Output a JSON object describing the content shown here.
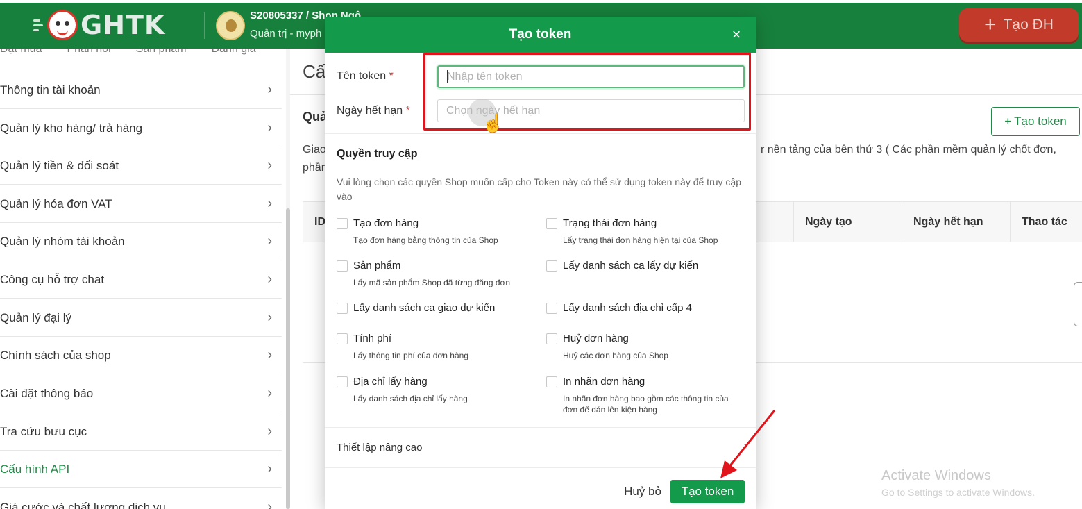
{
  "header": {
    "brand": "GHTK",
    "shop_code": "S20805337 / Shop Ngô",
    "shop_role": "Quản trị - myph",
    "create_order": "Tạo ĐH",
    "plus_icon": "+"
  },
  "sidebar": {
    "tabs": [
      "Đặt mua",
      "Phản hồi",
      "Sản phẩm",
      "Đánh giá"
    ],
    "items": [
      {
        "label": "Thông tin tài khoản"
      },
      {
        "label": "Quản lý kho hàng/ trả hàng"
      },
      {
        "label": "Quản lý tiền & đối soát"
      },
      {
        "label": "Quản lý hóa đơn VAT"
      },
      {
        "label": "Quản lý nhóm tài khoản"
      },
      {
        "label": "Công cụ hỗ trợ chat"
      },
      {
        "label": "Quản lý đại lý"
      },
      {
        "label": "Chính sách của shop"
      },
      {
        "label": "Cài đặt thông báo"
      },
      {
        "label": "Tra cứu bưu cục"
      },
      {
        "label": "Cấu hình API",
        "active": true
      },
      {
        "label": "Giá cước và chất lượng dịch vụ"
      }
    ],
    "chevron": "›"
  },
  "main": {
    "title": "Cấu",
    "subtitle": "Quả",
    "create_token_btn": "Tạo token",
    "desc_left": "Giao",
    "desc_right": "r nền tảng của bên thứ 3 ( Các phần mềm quản lý chốt đơn,",
    "desc_line2": "phần",
    "table_headers": {
      "id": "ID",
      "created": "Ngày tạo",
      "expiry": "Ngày hết hạn",
      "action": "Thao tác"
    }
  },
  "modal": {
    "title": "Tạo token",
    "close_icon": "×",
    "token_name_label": "Tên token",
    "token_name_placeholder": "Nhập tên token",
    "token_name_value": "",
    "expiry_label": "Ngày hết hạn",
    "expiry_placeholder": "Chọn ngày hết hạn",
    "required_mark": "*",
    "access_title": "Quyền truy cập",
    "access_desc": "Vui lòng chọn các quyền Shop muốn cấp cho Token này có thể sử dụng token này để truy cập vào",
    "permissions": [
      {
        "name": "Tạo đơn hàng",
        "desc": "Tạo đơn hàng bằng thông tin của Shop"
      },
      {
        "name": "Trạng thái đơn hàng",
        "desc": "Lấy trạng thái đơn hàng hiện tại của Shop"
      },
      {
        "name": "Sản phẩm",
        "desc": "Lấy mã sản phẩm Shop đã từng đăng đơn"
      },
      {
        "name": "Lấy danh sách ca lấy dự kiến",
        "desc": ""
      },
      {
        "name": "Lấy danh sách ca giao dự kiến",
        "desc": ""
      },
      {
        "name": "Lấy danh sách địa chỉ cấp 4",
        "desc": ""
      },
      {
        "name": "Tính phí",
        "desc": "Lấy thông tin phí của đơn hàng"
      },
      {
        "name": "Huỷ đơn hàng",
        "desc": "Huỷ các đơn hàng của Shop"
      },
      {
        "name": "Địa chỉ lấy hàng",
        "desc": "Lấy danh sách địa chỉ lấy hàng"
      },
      {
        "name": "In nhãn đơn hàng",
        "desc": "In nhãn đơn hàng bao gồm các thông tin của đơn để dán lên kiện hàng"
      }
    ],
    "advanced": "Thiết lập nâng cao",
    "advanced_chevron": "›",
    "cancel": "Huỷ bỏ",
    "submit": "Tạo token"
  },
  "watermark": {
    "line1": "Activate Windows",
    "line2": "Go to Settings to activate Windows."
  }
}
